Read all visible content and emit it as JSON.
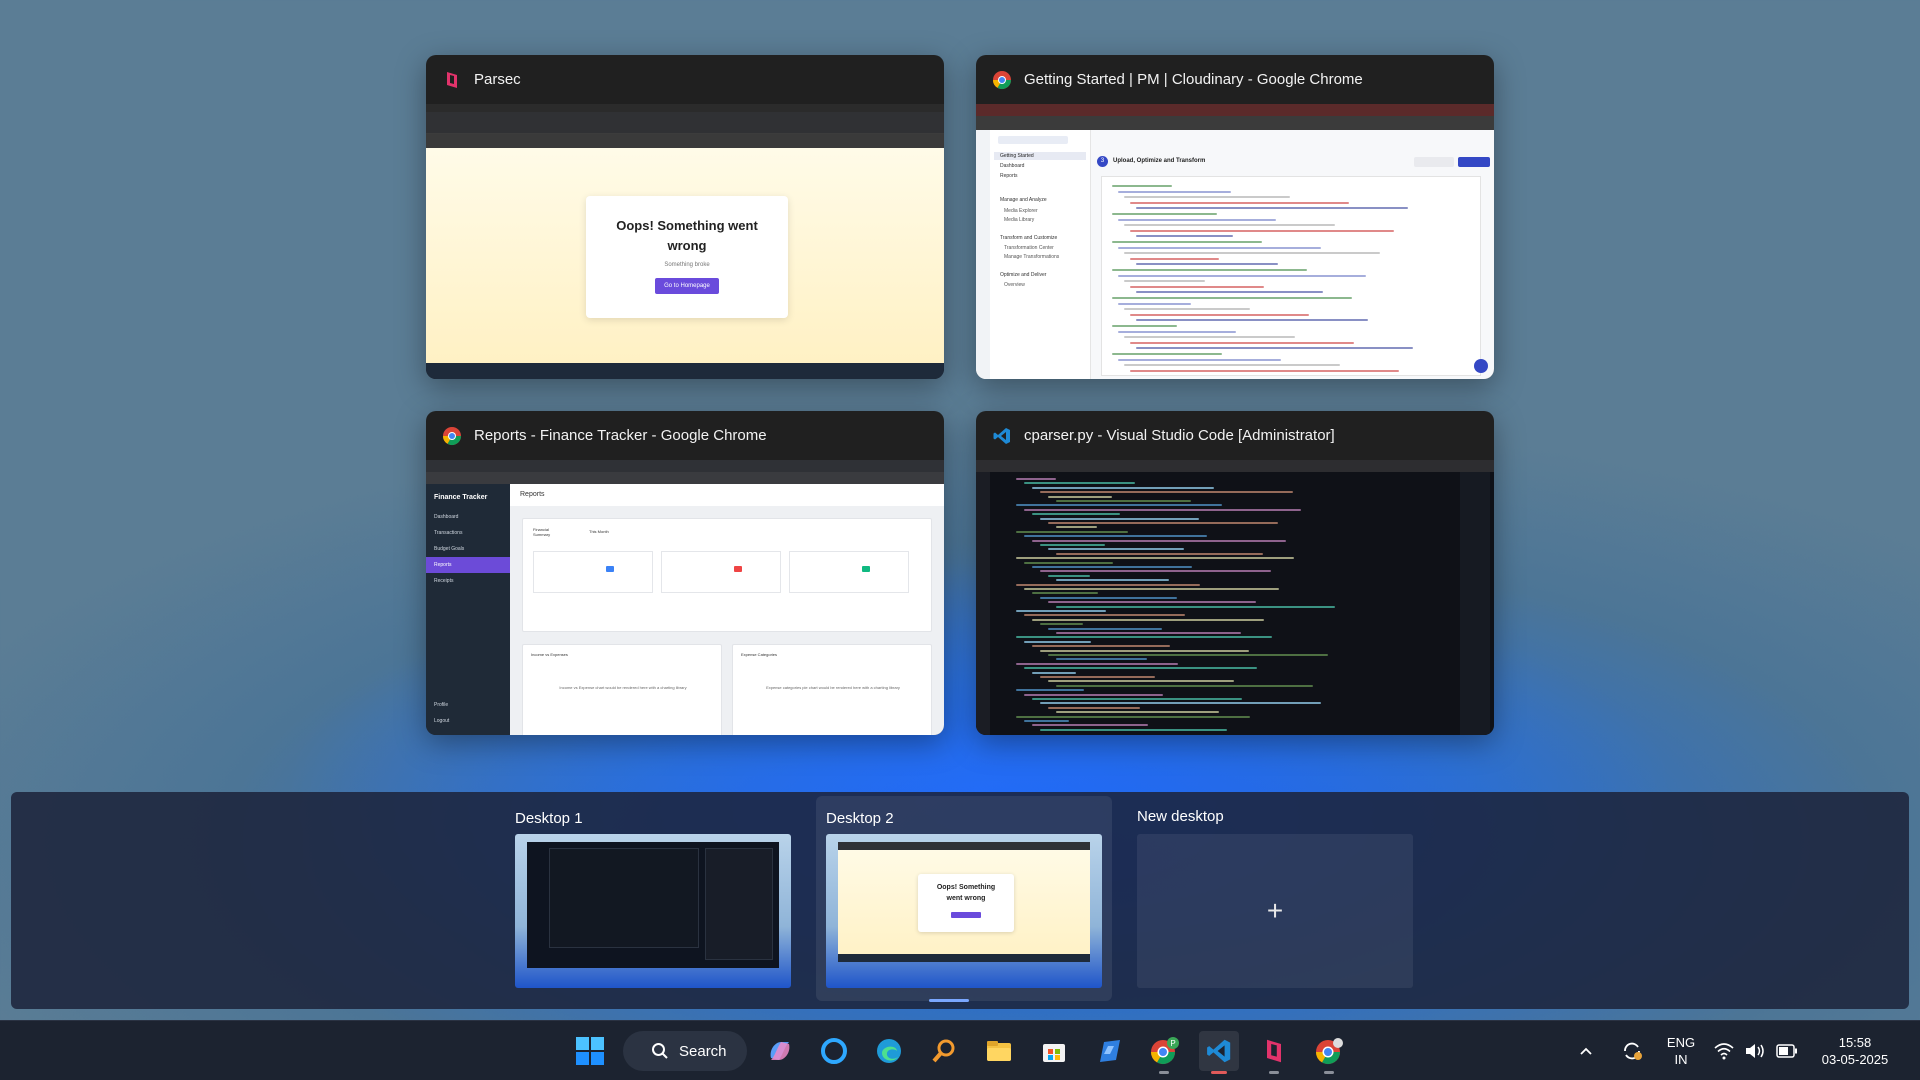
{
  "task_view": {
    "windows": [
      {
        "title": "Parsec",
        "icon": "parsec-icon"
      },
      {
        "title": "Getting Started | PM | Cloudinary - Google Chrome",
        "icon": "chrome-icon"
      },
      {
        "title": "Reports - Finance Tracker - Google Chrome",
        "icon": "chrome-icon"
      },
      {
        "title": "cparser.py - Visual Studio Code [Administrator]",
        "icon": "vscode-icon"
      }
    ],
    "parsec_preview": {
      "heading": "Oops! Something went wrong",
      "subtext": "Something broke",
      "button": "Go to Homepage"
    },
    "cloudinary_preview": {
      "section": "Upload, Optimize and Transform",
      "step": "3",
      "sidebar": [
        "Getting Started",
        "Dashboard",
        "Reports",
        "Manage and Analyze",
        "Media Explorer",
        "Media Library",
        "Transform and Customize",
        "Transformation Center",
        "Manage Transformations",
        "Optimize and Deliver",
        "Overview"
      ]
    },
    "finance_preview": {
      "brand": "Finance Tracker",
      "nav": [
        "Dashboard",
        "Transactions",
        "Budget Goals",
        "Reports",
        "Receipts"
      ],
      "nav_bottom": [
        "Profile",
        "Logout"
      ],
      "page_title": "Reports",
      "summary_title": "Financial Summary",
      "period": "This Month",
      "income_vs_expenses": "Income vs Expenses",
      "expense_categories": "Expense Categories",
      "income_note": "Income vs Expense chart would be rendered here with a charting library",
      "expense_note": "Expense categories pie chart would be rendered here with a charting library"
    }
  },
  "desktops": [
    {
      "label": "Desktop 1"
    },
    {
      "label": "Desktop 2",
      "selected": true
    },
    {
      "label": "New desktop",
      "add_symbol": "+"
    }
  ],
  "desktop2_preview": {
    "heading": "Oops! Something went wrong"
  },
  "taskbar": {
    "search_label": "Search",
    "pinned": [
      "windows-start-icon",
      "copilot-icon",
      "cortana-icon",
      "edge-icon",
      "search-magnifier-icon",
      "file-explorer-icon",
      "microsoft-store-icon",
      "app-icon-blue",
      "chrome-icon",
      "vscode-icon",
      "parsec-icon",
      "chrome-dev-icon"
    ],
    "language_line1": "ENG",
    "language_line2": "IN",
    "time": "15:58",
    "date": "03-05-2025"
  }
}
